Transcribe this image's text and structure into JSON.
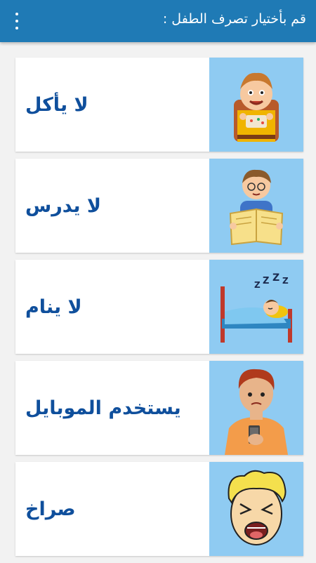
{
  "header": {
    "title": "قم بأختيار تصرف الطفل :",
    "menu_icon": "more-vert-icon"
  },
  "colors": {
    "appbar": "#1f7ab5",
    "card_image_bg": "#8fcbf2",
    "label_text": "#0f4f9c"
  },
  "options": [
    {
      "label": "لا يأكل",
      "icon": "boy-eating-icon"
    },
    {
      "label": "لا يدرس",
      "icon": "boy-studying-icon"
    },
    {
      "label": "لا ينام",
      "icon": "boy-sleeping-icon"
    },
    {
      "label": "يستخدم الموبايل",
      "icon": "boy-using-phone-icon"
    },
    {
      "label": "صراخ",
      "icon": "boy-screaming-icon"
    }
  ]
}
